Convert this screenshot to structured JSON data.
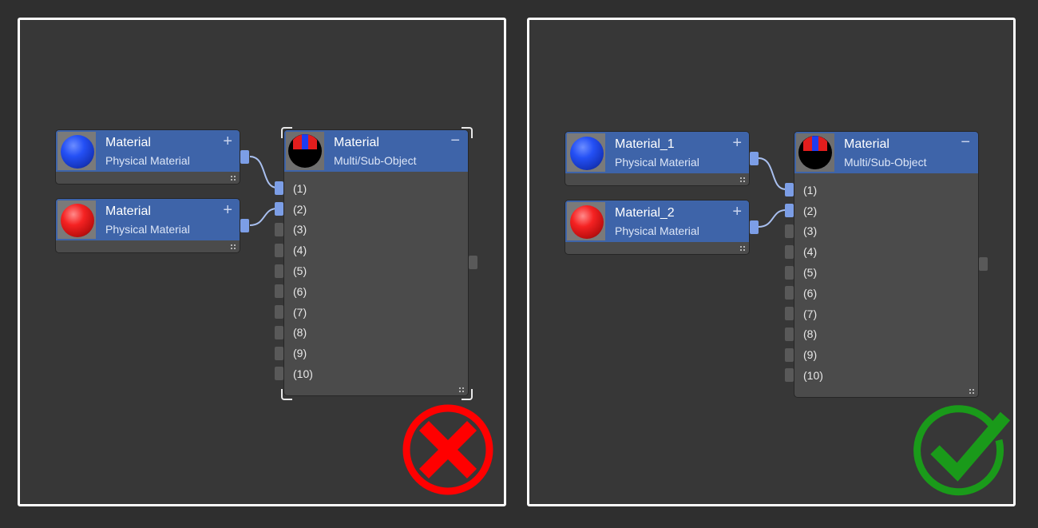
{
  "panels": [
    {
      "status": "incorrect",
      "status_color": "#ff0000",
      "status_icon": "x-circle-icon",
      "inputs": [
        {
          "title": "Material",
          "subtitle": "Physical Material",
          "swatch": "blue",
          "expand_icon": "plus-icon"
        },
        {
          "title": "Material",
          "subtitle": "Physical Material",
          "swatch": "red",
          "expand_icon": "plus-icon"
        }
      ],
      "multi": {
        "title": "Material",
        "subtitle": "Multi/Sub-Object",
        "collapse_icon": "minus-icon",
        "selected": true,
        "slots": [
          "(1)",
          "(2)",
          "(3)",
          "(4)",
          "(5)",
          "(6)",
          "(7)",
          "(8)",
          "(9)",
          "(10)"
        ]
      }
    },
    {
      "status": "correct",
      "status_color": "#1a9a1a",
      "status_icon": "check-circle-icon",
      "inputs": [
        {
          "title": "Material_1",
          "subtitle": "Physical Material",
          "swatch": "blue",
          "expand_icon": "plus-icon"
        },
        {
          "title": "Material_2",
          "subtitle": "Physical Material",
          "swatch": "red",
          "expand_icon": "plus-icon"
        }
      ],
      "multi": {
        "title": "Material",
        "subtitle": "Multi/Sub-Object",
        "collapse_icon": "minus-icon",
        "selected": false,
        "slots": [
          "(1)",
          "(2)",
          "(3)",
          "(4)",
          "(5)",
          "(6)",
          "(7)",
          "(8)",
          "(9)",
          "(10)"
        ]
      }
    }
  ],
  "colors": {
    "node_header": "#3e64a9",
    "wire": "#a9c0f0",
    "socket_connected": "#7c9ee6"
  },
  "icons": {
    "plus": "+",
    "minus": "−"
  }
}
